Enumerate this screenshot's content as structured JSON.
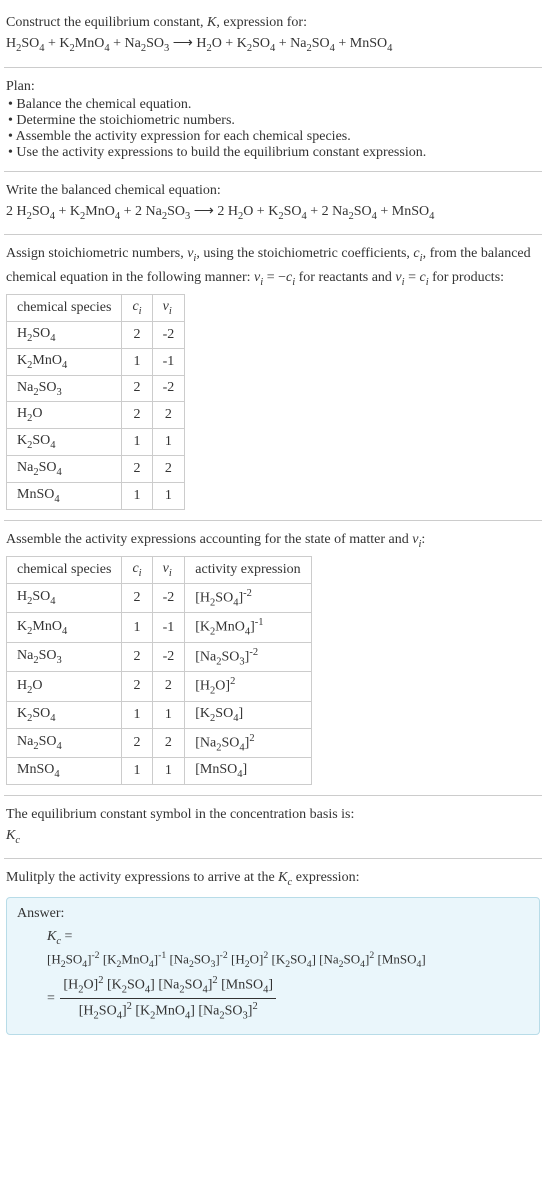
{
  "intro": {
    "prompt_prefix": "Construct the equilibrium constant, ",
    "prompt_K": "K",
    "prompt_suffix": ", expression for:",
    "equation_html": "H<sub>2</sub>SO<sub>4</sub> + K<sub>2</sub>MnO<sub>4</sub> + Na<sub>2</sub>SO<sub>3</sub> ⟶ H<sub>2</sub>O + K<sub>2</sub>SO<sub>4</sub> + Na<sub>2</sub>SO<sub>4</sub> + MnSO<sub>4</sub>"
  },
  "plan": {
    "title": "Plan:",
    "items": [
      "Balance the chemical equation.",
      "Determine the stoichiometric numbers.",
      "Assemble the activity expression for each chemical species.",
      "Use the activity expressions to build the equilibrium constant expression."
    ]
  },
  "balanced": {
    "title": "Write the balanced chemical equation:",
    "equation_html": "2 H<sub>2</sub>SO<sub>4</sub> + K<sub>2</sub>MnO<sub>4</sub> + 2 Na<sub>2</sub>SO<sub>3</sub> ⟶ 2 H<sub>2</sub>O + K<sub>2</sub>SO<sub>4</sub> + 2 Na<sub>2</sub>SO<sub>4</sub> + MnSO<sub>4</sub>"
  },
  "stoich": {
    "text_html": "Assign stoichiometric numbers, <span class=\"italic\">ν<sub>i</sub></span>, using the stoichiometric coefficients, <span class=\"italic\">c<sub>i</sub></span>, from the balanced chemical equation in the following manner: <span class=\"italic\">ν<sub>i</sub></span> = −<span class=\"italic\">c<sub>i</sub></span> for reactants and <span class=\"italic\">ν<sub>i</sub></span> = <span class=\"italic\">c<sub>i</sub></span> for products:",
    "headers": {
      "species": "chemical species",
      "ci_html": "<span class=\"italic\">c<sub>i</sub></span>",
      "vi_html": "<span class=\"italic\">ν<sub>i</sub></span>"
    },
    "rows": [
      {
        "species_html": "H<sub>2</sub>SO<sub>4</sub>",
        "ci": "2",
        "vi": "-2"
      },
      {
        "species_html": "K<sub>2</sub>MnO<sub>4</sub>",
        "ci": "1",
        "vi": "-1"
      },
      {
        "species_html": "Na<sub>2</sub>SO<sub>3</sub>",
        "ci": "2",
        "vi": "-2"
      },
      {
        "species_html": "H<sub>2</sub>O",
        "ci": "2",
        "vi": "2"
      },
      {
        "species_html": "K<sub>2</sub>SO<sub>4</sub>",
        "ci": "1",
        "vi": "1"
      },
      {
        "species_html": "Na<sub>2</sub>SO<sub>4</sub>",
        "ci": "2",
        "vi": "2"
      },
      {
        "species_html": "MnSO<sub>4</sub>",
        "ci": "1",
        "vi": "1"
      }
    ]
  },
  "activity": {
    "title_html": "Assemble the activity expressions accounting for the state of matter and <span class=\"italic\">ν<sub>i</sub></span>:",
    "headers": {
      "species": "chemical species",
      "ci_html": "<span class=\"italic\">c<sub>i</sub></span>",
      "vi_html": "<span class=\"italic\">ν<sub>i</sub></span>",
      "activity": "activity expression"
    },
    "rows": [
      {
        "species_html": "H<sub>2</sub>SO<sub>4</sub>",
        "ci": "2",
        "vi": "-2",
        "act_html": "[H<sub>2</sub>SO<sub>4</sub>]<sup>-2</sup>"
      },
      {
        "species_html": "K<sub>2</sub>MnO<sub>4</sub>",
        "ci": "1",
        "vi": "-1",
        "act_html": "[K<sub>2</sub>MnO<sub>4</sub>]<sup>-1</sup>"
      },
      {
        "species_html": "Na<sub>2</sub>SO<sub>3</sub>",
        "ci": "2",
        "vi": "-2",
        "act_html": "[Na<sub>2</sub>SO<sub>3</sub>]<sup>-2</sup>"
      },
      {
        "species_html": "H<sub>2</sub>O",
        "ci": "2",
        "vi": "2",
        "act_html": "[H<sub>2</sub>O]<sup>2</sup>"
      },
      {
        "species_html": "K<sub>2</sub>SO<sub>4</sub>",
        "ci": "1",
        "vi": "1",
        "act_html": "[K<sub>2</sub>SO<sub>4</sub>]"
      },
      {
        "species_html": "Na<sub>2</sub>SO<sub>4</sub>",
        "ci": "2",
        "vi": "2",
        "act_html": "[Na<sub>2</sub>SO<sub>4</sub>]<sup>2</sup>"
      },
      {
        "species_html": "MnSO<sub>4</sub>",
        "ci": "1",
        "vi": "1",
        "act_html": "[MnSO<sub>4</sub>]"
      }
    ]
  },
  "symbol": {
    "text": "The equilibrium constant symbol in the concentration basis is:",
    "sym_html": "<span class=\"italic\">K<sub>c</sub></span>"
  },
  "multiply": {
    "text_html": "Mulitply the activity expressions to arrive at the <span class=\"italic\">K<sub>c</sub></span> expression:"
  },
  "answer": {
    "label": "Answer:",
    "line1_html": "<span class=\"italic\">K<sub>c</sub></span> =",
    "line2_html": "[H<sub>2</sub>SO<sub>4</sub>]<sup>-2</sup> [K<sub>2</sub>MnO<sub>4</sub>]<sup>-1</sup> [Na<sub>2</sub>SO<sub>3</sub>]<sup>-2</sup> [H<sub>2</sub>O]<sup>2</sup> [K<sub>2</sub>SO<sub>4</sub>] [Na<sub>2</sub>SO<sub>4</sub>]<sup>2</sup> [MnSO<sub>4</sub>]",
    "frac_num_html": "[H<sub>2</sub>O]<sup>2</sup> [K<sub>2</sub>SO<sub>4</sub>] [Na<sub>2</sub>SO<sub>4</sub>]<sup>2</sup> [MnSO<sub>4</sub>]",
    "frac_den_html": "[H<sub>2</sub>SO<sub>4</sub>]<sup>2</sup> [K<sub>2</sub>MnO<sub>4</sub>] [Na<sub>2</sub>SO<sub>3</sub>]<sup>2</sup>"
  }
}
